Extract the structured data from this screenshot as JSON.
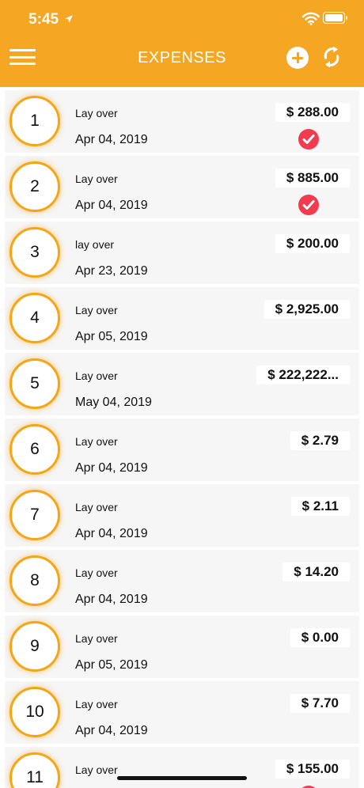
{
  "status": {
    "time": "5:45"
  },
  "header": {
    "title": "EXPENSES"
  },
  "expenses": [
    {
      "index": "1",
      "desc": "Lay over",
      "date": "Apr 04, 2019",
      "amount": "$ 288.00",
      "paid": true
    },
    {
      "index": "2",
      "desc": "Lay over",
      "date": "Apr 04, 2019",
      "amount": "$ 885.00",
      "paid": true
    },
    {
      "index": "3",
      "desc": "lay over",
      "date": "Apr 23, 2019",
      "amount": "$ 200.00",
      "paid": false
    },
    {
      "index": "4",
      "desc": "Lay over",
      "date": "Apr 05, 2019",
      "amount": "$ 2,925.00",
      "paid": false
    },
    {
      "index": "5",
      "desc": "Lay over",
      "date": "May 04, 2019",
      "amount": "$ 222,222...",
      "paid": false
    },
    {
      "index": "6",
      "desc": "Lay over",
      "date": "Apr 04, 2019",
      "amount": "$ 2.79",
      "paid": false
    },
    {
      "index": "7",
      "desc": "Lay over",
      "date": "Apr 04, 2019",
      "amount": "$ 2.11",
      "paid": false
    },
    {
      "index": "8",
      "desc": "Lay over",
      "date": "Apr 04, 2019",
      "amount": "$ 14.20",
      "paid": false
    },
    {
      "index": "9",
      "desc": "Lay over",
      "date": "Apr 05, 2019",
      "amount": "$ 0.00",
      "paid": false
    },
    {
      "index": "10",
      "desc": "Lay over",
      "date": "Apr 04, 2019",
      "amount": "$ 7.70",
      "paid": false
    },
    {
      "index": "11",
      "desc": "Lay over",
      "date": "",
      "amount": "$ 155.00",
      "paid": true
    }
  ],
  "colors": {
    "accent": "#f5a623",
    "check": "#f33a4e"
  }
}
